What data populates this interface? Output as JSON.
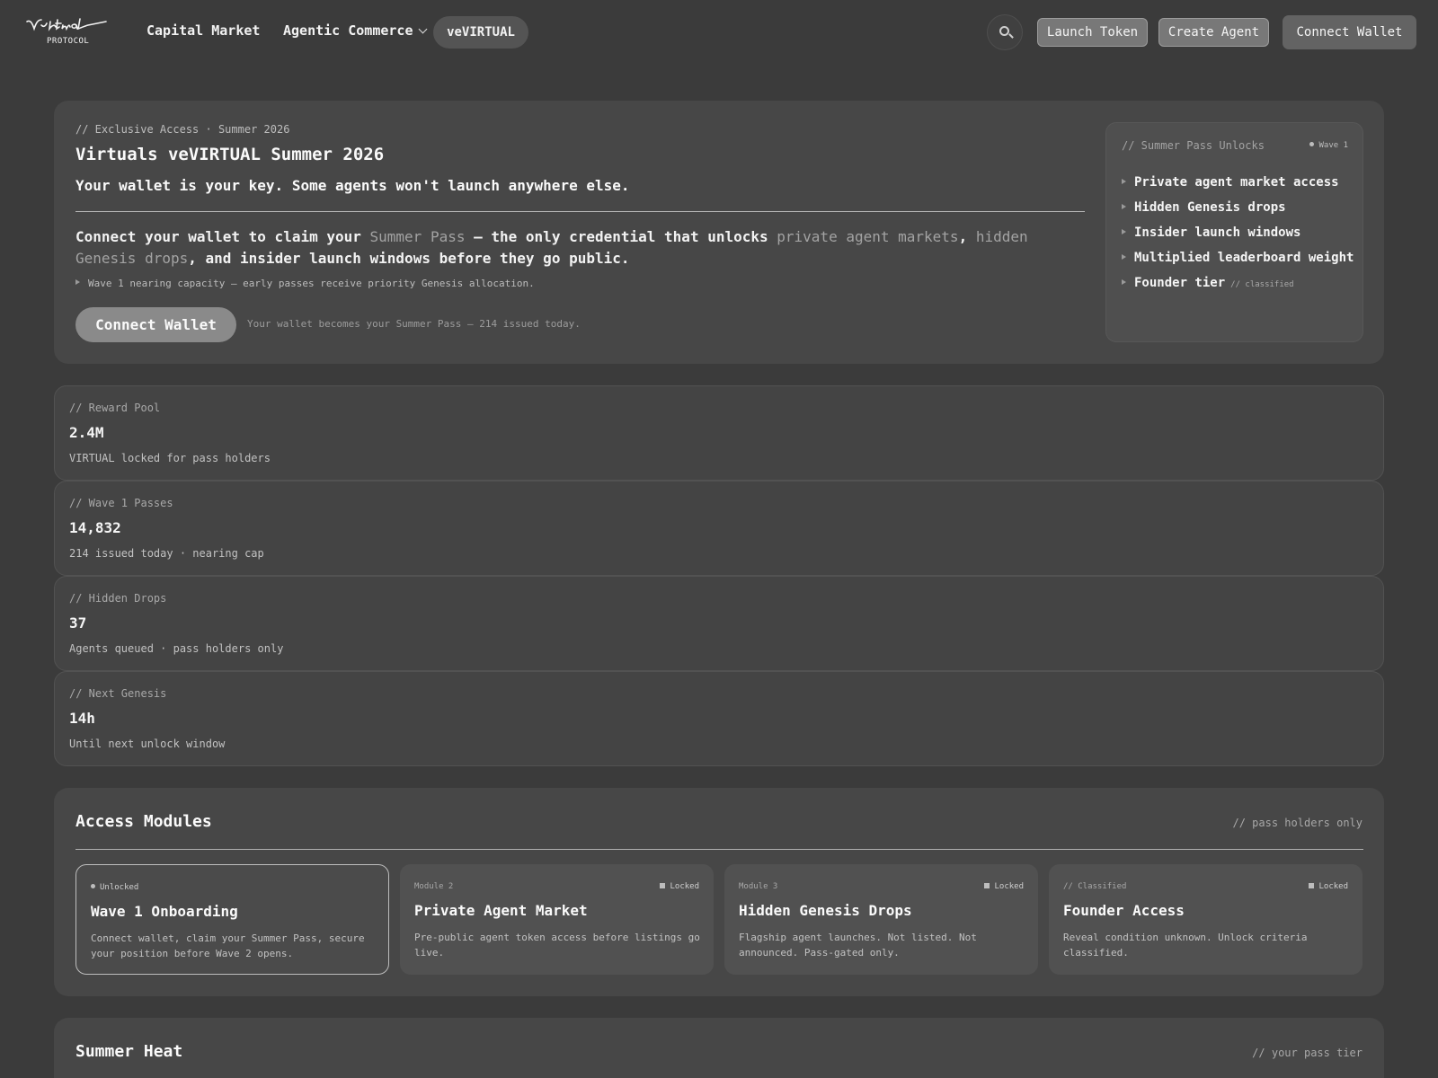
{
  "nav": {
    "logo_text": "Virtuals",
    "logo_sub": "PROTOCOL",
    "links": [
      "Capital Market",
      "Agentic Commerce",
      "veVIRTUAL"
    ],
    "search_icon": "search-icon",
    "launch_token": "Launch Token",
    "create_agent": "Create Agent",
    "connect_wallet": "Connect Wallet"
  },
  "hero": {
    "eyebrow": "// Exclusive Access · Summer 2026",
    "title": "Virtuals veVIRTUAL Summer 2026",
    "subtitle": "Your wallet is your key. Some agents won't launch anywhere else.",
    "body_1": "Connect your wallet to claim your ",
    "body_hl_1": "Summer Pass",
    "body_2": " — the only credential that unlocks ",
    "body_hl_2": "private agent markets",
    "body_3": ", ",
    "body_hl_3": "hidden Genesis drops",
    "body_4": ", and insider launch windows before they go public.",
    "note": "Wave 1 nearing capacity — early passes receive priority Genesis allocation.",
    "cta": "Connect Wallet",
    "cta_note": "Your wallet becomes your Summer Pass — 214 issued today."
  },
  "unlocks": {
    "heading": "// Summer Pass Unlocks",
    "badge": "Wave 1",
    "items": [
      "Private agent market access",
      "Hidden Genesis drops",
      "Insider launch windows",
      "Multiplied leaderboard weight",
      "Founder tier"
    ],
    "classified": "// classified"
  },
  "stats": [
    {
      "label": "// Reward Pool",
      "value": "2.4M",
      "desc": "VIRTUAL locked for pass holders"
    },
    {
      "label": "// Wave 1 Passes",
      "value": "14,832",
      "desc": "214 issued today · nearing cap"
    },
    {
      "label": "// Hidden Drops",
      "value": "37",
      "desc": "Agents queued · pass holders only"
    },
    {
      "label": "// Next Genesis",
      "value": "14h",
      "desc": "Until next unlock window"
    }
  ],
  "modules": {
    "title": "Access Modules",
    "note": "// pass holders only",
    "items": [
      {
        "tag": "Unlocked",
        "status": "",
        "title": "Wave 1 Onboarding",
        "desc": "Connect wallet, claim your Summer Pass, secure your position before Wave 2 opens."
      },
      {
        "tag": "Module 2",
        "status": "Locked",
        "title": "Private Agent Market",
        "desc": "Pre-public agent token access before listings go live."
      },
      {
        "tag": "Module 3",
        "status": "Locked",
        "title": "Hidden Genesis Drops",
        "desc": "Flagship agent launches. Not listed. Not announced. Pass-gated only."
      },
      {
        "tag": "// Classified",
        "status": "Locked",
        "title": "Founder Access",
        "desc": "Reveal condition unknown. Unlock criteria classified."
      }
    ]
  },
  "heat": {
    "title": "Summer Heat",
    "note": "// your pass tier"
  }
}
